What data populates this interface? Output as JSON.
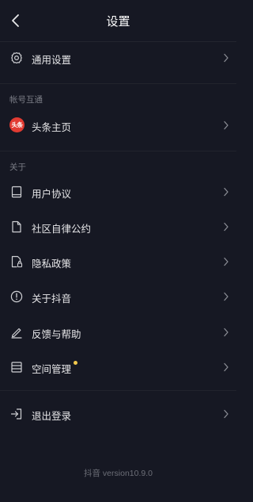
{
  "nav": {
    "title": "设置"
  },
  "general": {
    "label": "通用设置"
  },
  "account_section": {
    "title": "帐号互通",
    "toutiao": {
      "badge": "头条",
      "label": "头条主页"
    }
  },
  "about_section": {
    "title": "关于",
    "items": [
      {
        "label": "用户协议",
        "icon": "book-icon"
      },
      {
        "label": "社区自律公约",
        "icon": "document-icon"
      },
      {
        "label": "隐私政策",
        "icon": "privacy-lock-icon"
      },
      {
        "label": "关于抖音",
        "icon": "info-icon"
      },
      {
        "label": "反馈与帮助",
        "icon": "edit-pen-icon"
      },
      {
        "label": "空间管理",
        "icon": "storage-icon",
        "badge_dot": true
      }
    ]
  },
  "logout": {
    "label": "退出登录"
  },
  "footer": {
    "version": "抖音 version10.9.0"
  },
  "colors": {
    "background": "#161823",
    "badge_dot": "#f2c94c",
    "toutiao_red": "#e23b32"
  }
}
